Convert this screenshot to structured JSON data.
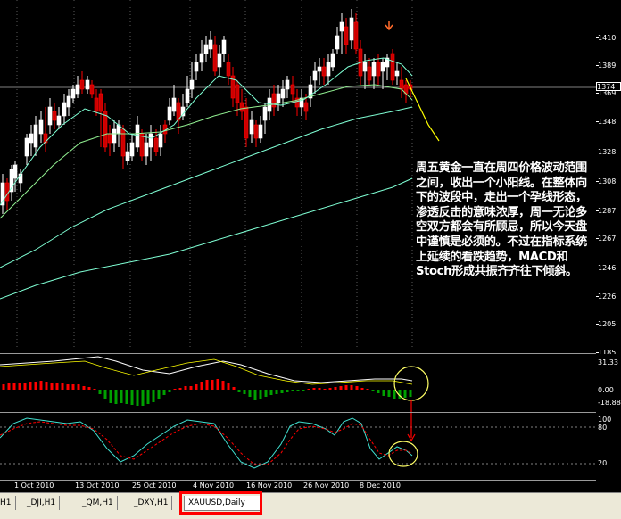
{
  "window": {
    "title": "XAUUSD,Daily"
  },
  "price_scale": {
    "ticks": [
      "1410",
      "1389",
      "1369",
      "1348",
      "1328",
      "1308",
      "1287",
      "1267",
      "1246",
      "1226",
      "1205",
      "1185"
    ],
    "current": "1374"
  },
  "macd_scale": {
    "ticks": [
      "31.33",
      "0.00",
      "-18.88"
    ]
  },
  "stoch_scale": {
    "ticks": [
      "100",
      "80",
      "20"
    ]
  },
  "dates": [
    "1 Oct 2010",
    "13 Oct 2010",
    "25 Oct 2010",
    "4 Nov 2010",
    "16 Nov 2010",
    "26 Nov 2010",
    "8 Dec 2010"
  ],
  "annotation": {
    "text": "周五黄金一直在周四价格波动范围之间，收出一个小阳线。在整体向下的波段中，走出一个孕线形态，渗透反击的意味浓厚，周一无论多空双方都会有所顾忌，所以今天盘中谨慎是必须的。不过在指标系统上延续的看跌趋势，MACD和Stoch形成共振齐齐往下倾斜。"
  },
  "tabs": [
    {
      "label": "H1",
      "active": false
    },
    {
      "label": "_DJI,H1",
      "active": false
    },
    {
      "label": "_QM,H1",
      "active": false
    },
    {
      "label": "_DXY,H1",
      "active": false
    },
    {
      "label": "XAUUSD,Daily",
      "active": true
    }
  ],
  "colors": {
    "bull": "#ffffff",
    "bear": "#ff0000",
    "bull_fill": "#ffffff",
    "bear_fill": "#cc0000",
    "ma_fast": "#7fffd4",
    "ma_slow": "#90ee90",
    "trend_line": "#ffff00",
    "macd_pos": "#ff0000",
    "macd_neg": "#00a000",
    "signal": "#ffffff",
    "stoch_main": "#40e0d0",
    "stoch_signal": "#ff0000"
  }
}
